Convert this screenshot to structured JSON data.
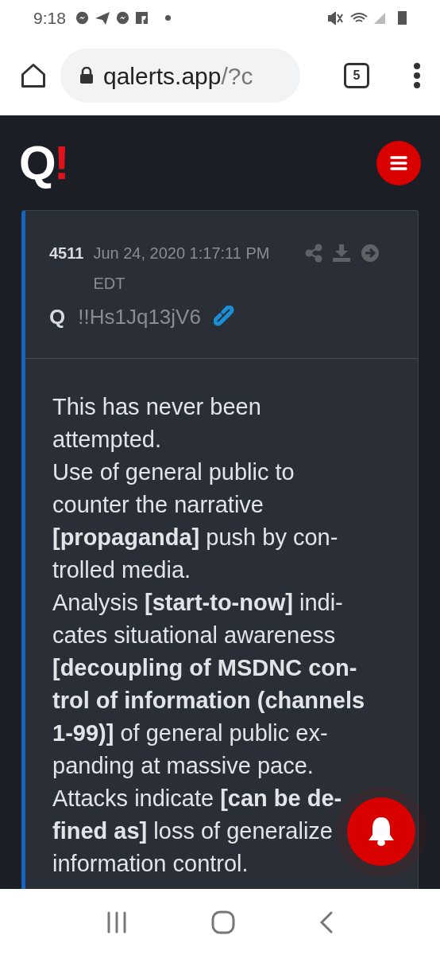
{
  "status_bar": {
    "time": "9:18"
  },
  "browser": {
    "url_host": "qalerts.app",
    "url_rest": "/?c",
    "tab_count": "5"
  },
  "site": {
    "logo_letter": "Q",
    "logo_mark": "!"
  },
  "post": {
    "number": "4511",
    "date": "Jun 24, 2020 1:17:11 PM EDT",
    "author": "Q",
    "tripcode": "!!Hs1Jq13jV6",
    "paragraphs": [
      {
        "lines": [
          "This has never been",
          "attempted."
        ]
      },
      {
        "lines": [
          "Use of general public to",
          "counter the narrative",
          "**[propaganda]** push by con-",
          "trolled media."
        ]
      },
      {
        "lines": [
          "Analysis **[start-to-now]** indi-",
          "cates situational awareness",
          "**[decoupling of MSDNC con-**",
          "**trol of information (channels**",
          "**1-99)]** of general public ex-",
          "panding at massive pace."
        ]
      },
      {
        "lines": [
          "Attacks indicate **[can be de-**",
          "**fined as]** loss of generalize",
          "information control."
        ]
      }
    ]
  }
}
